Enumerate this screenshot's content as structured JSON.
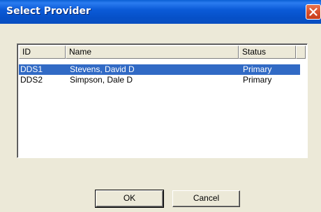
{
  "window": {
    "title": "Select Provider"
  },
  "list": {
    "columns": [
      "ID",
      "Name",
      "Status",
      ""
    ],
    "rows": [
      {
        "id": "DDS1",
        "name": "Stevens, David D",
        "status": "Primary",
        "selected": true
      },
      {
        "id": "DDS2",
        "name": "Simpson, Dale D",
        "status": "Primary",
        "selected": false
      }
    ]
  },
  "buttons": {
    "ok": "OK",
    "cancel": "Cancel"
  },
  "icons": {
    "close": "close-icon"
  },
  "colors": {
    "titlebar": "#0a5fd4",
    "selection": "#316ac5",
    "close": "#d8502c"
  }
}
